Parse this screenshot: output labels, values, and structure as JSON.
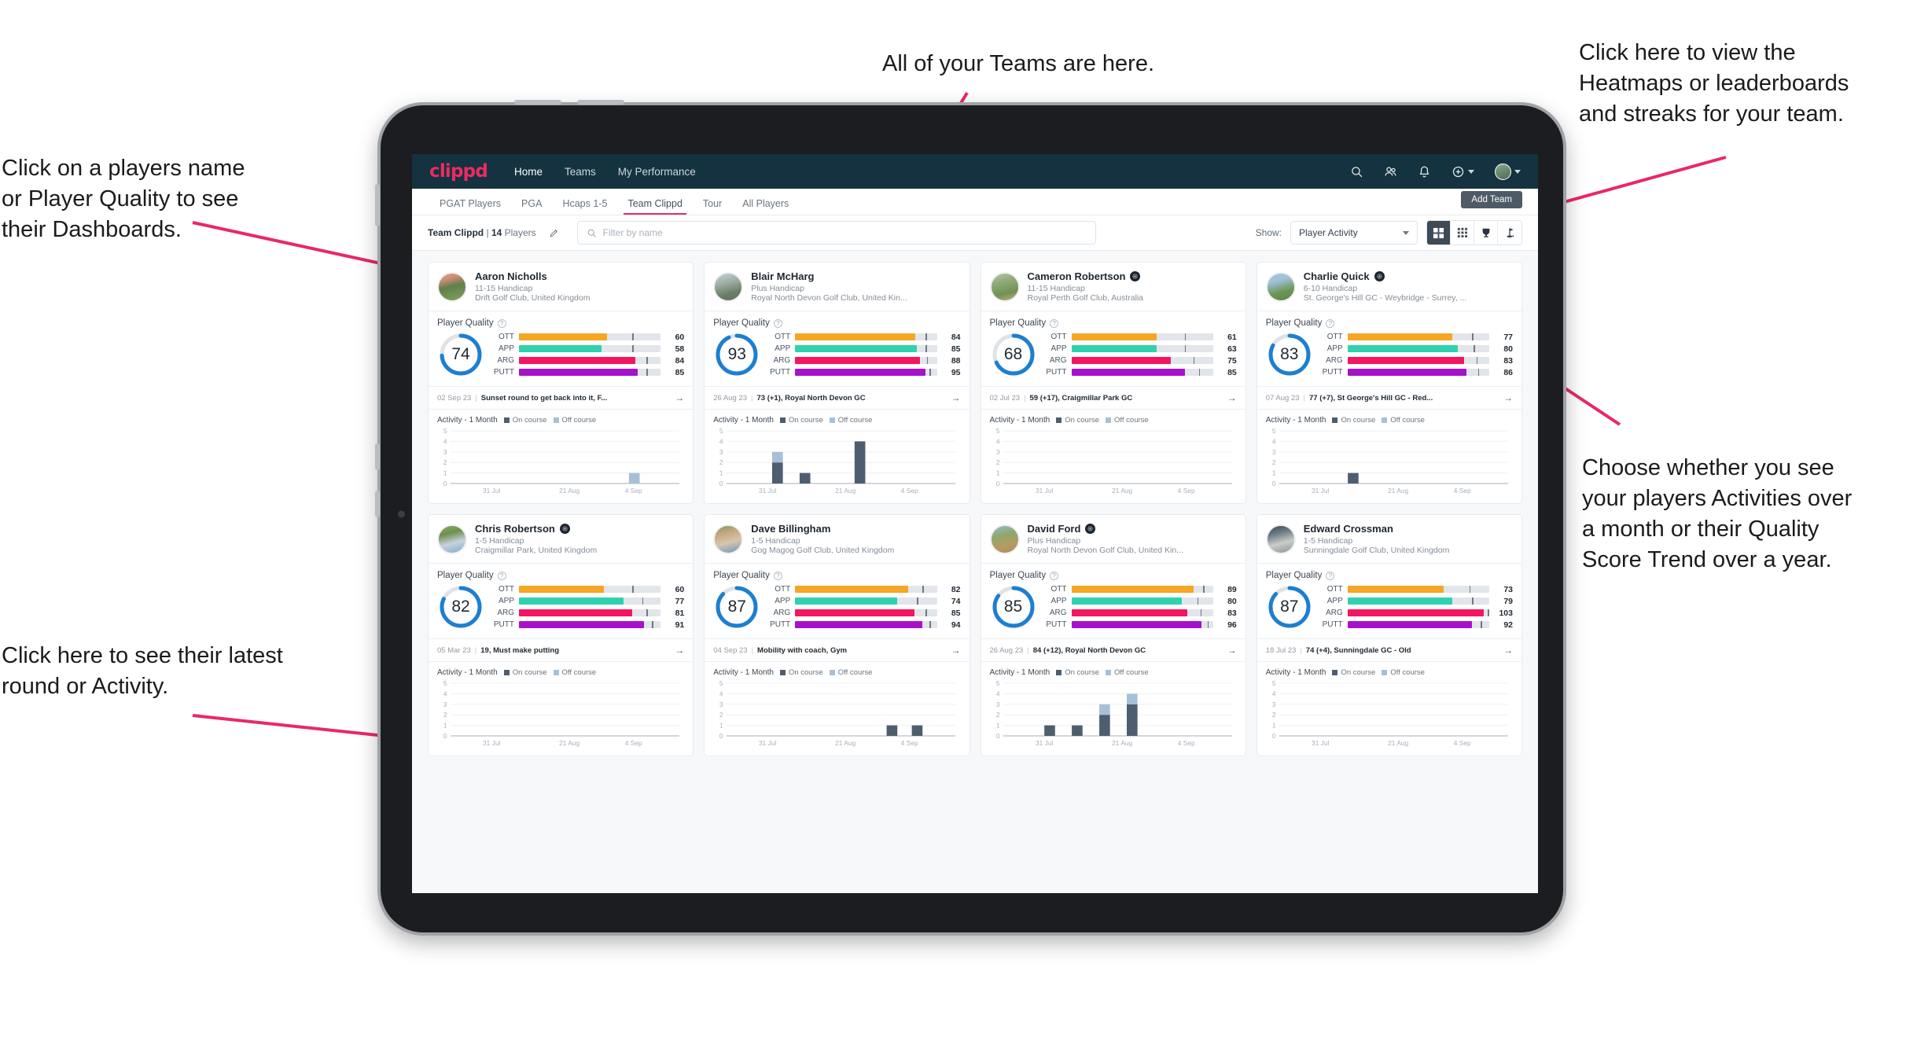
{
  "annotations": [
    {
      "id": "teams",
      "text": "All of your Teams are here."
    },
    {
      "id": "heatmaps",
      "text": "Click here to view the\nHeatmaps or leaderboards\nand streaks for your team."
    },
    {
      "id": "dashboards",
      "text": "Click on a players name\nor Player Quality to see\ntheir Dashboards."
    },
    {
      "id": "activity-choice",
      "text": "Choose whether you see\nyour players Activities over\na month or their Quality\nScore Trend over a year."
    },
    {
      "id": "latest-round",
      "text": "Click here to see their latest\nround or Activity."
    }
  ],
  "app": {
    "logo": "clippd",
    "nav_links": [
      {
        "label": "Home",
        "active": true
      },
      {
        "label": "Teams",
        "active": false
      },
      {
        "label": "My Performance",
        "active": false
      }
    ],
    "nav_icons": [
      "search-icon",
      "people-icon",
      "bell-icon",
      "add-circle-icon",
      "avatar-icon"
    ],
    "tabs": [
      {
        "label": "PGAT Players",
        "active": false
      },
      {
        "label": "PGA",
        "active": false
      },
      {
        "label": "Hcaps 1-5",
        "active": false
      },
      {
        "label": "Team Clippd",
        "active": true
      },
      {
        "label": "Tour",
        "active": false
      },
      {
        "label": "All Players",
        "active": false
      }
    ],
    "add_team_label": "Add Team",
    "toolbar": {
      "team_name": "Team Clippd",
      "separator": "|",
      "player_count": "14",
      "players_word": "Players",
      "edit_icon": "pencil-icon",
      "search_placeholder": "Filter by name",
      "search_value": "",
      "show_label": "Show:",
      "show_value": "Player Activity",
      "show_options": [
        "Player Activity",
        "Quality Score Trend"
      ],
      "view_buttons": [
        {
          "icon": "grid-large-icon",
          "active": true
        },
        {
          "icon": "grid-small-icon",
          "active": false
        },
        {
          "icon": "trophy-icon",
          "active": false
        },
        {
          "icon": "golf-flag-icon",
          "active": false
        }
      ]
    }
  },
  "card_labels": {
    "player_quality": "Player Quality",
    "help_icon": "question-mark-icon",
    "activity_title": "Activity - 1 Month",
    "legend_on": "On course",
    "legend_off": "Off course",
    "arrow_icon": "arrow-right-icon",
    "metric_labels": [
      "OTT",
      "APP",
      "ARG",
      "PUTT"
    ]
  },
  "colors": {
    "brand_pink": "#ec2a63",
    "nav_bg": "#14323f",
    "ring_blue": "#1d7fd0",
    "ott_amber": "#f5a623",
    "app_teal": "#2fd2ae",
    "arg_pink": "#f4165e",
    "putt_purple": "#a711c9",
    "on_course": "#4e5e6e",
    "off_course": "#a7c0d8",
    "add_team_bg": "#4e5b66",
    "toggle_active_bg": "#3e4a55"
  },
  "chart_data": {
    "type": "bar",
    "title": "Activity - 1 Month",
    "xlabel": "",
    "ylabel": "",
    "ylim": [
      0,
      5
    ],
    "yticks": [
      0,
      1,
      2,
      3,
      4,
      5
    ],
    "xticks": [
      "31 Jul",
      "21 Aug",
      "4 Sep"
    ],
    "grid": true,
    "legend": [
      "On course",
      "Off course"
    ],
    "legend_position": "top",
    "stacked": true,
    "panels": [
      {
        "player": "Aaron Nicholls",
        "bars": [
          {
            "pos": 0.78,
            "on": 0,
            "off": 1
          }
        ]
      },
      {
        "player": "Blair McHarg",
        "bars": [
          {
            "pos": 0.2,
            "on": 2,
            "off": 1
          },
          {
            "pos": 0.32,
            "on": 1,
            "off": 0
          },
          {
            "pos": 0.56,
            "on": 4,
            "off": 0
          }
        ]
      },
      {
        "player": "Cameron Robertson",
        "bars": []
      },
      {
        "player": "Charlie Quick",
        "bars": [
          {
            "pos": 0.3,
            "on": 1,
            "off": 0
          }
        ]
      },
      {
        "player": "Chris Robertson",
        "bars": []
      },
      {
        "player": "Dave Billingham",
        "bars": [
          {
            "pos": 0.7,
            "on": 1,
            "off": 0
          },
          {
            "pos": 0.81,
            "on": 1,
            "off": 0
          }
        ]
      },
      {
        "player": "David Ford",
        "bars": [
          {
            "pos": 0.18,
            "on": 1,
            "off": 0
          },
          {
            "pos": 0.3,
            "on": 1,
            "off": 0
          },
          {
            "pos": 0.42,
            "on": 2,
            "off": 1
          },
          {
            "pos": 0.54,
            "on": 3,
            "off": 1
          }
        ]
      },
      {
        "player": "Edward Crossman",
        "bars": []
      }
    ]
  },
  "players": [
    {
      "name": "Aaron Nicholls",
      "verified": false,
      "handicap": "11-15 Handicap",
      "club": "Drift Golf Club, United Kingdom",
      "quality": 74,
      "metrics": [
        {
          "label": "OTT",
          "value": 60,
          "fill": 62,
          "tick": 80
        },
        {
          "label": "APP",
          "value": 58,
          "fill": 58,
          "tick": 80
        },
        {
          "label": "ARG",
          "value": 84,
          "fill": 82,
          "tick": 90
        },
        {
          "label": "PUTT",
          "value": 85,
          "fill": 84,
          "tick": 90
        }
      ],
      "round_date": "02 Sep 23",
      "round_text": "Sunset round to get back into it, F...",
      "avatar_css": "linear-gradient(165deg,#e8a072 0%,#cf8f77 22%,#5f7f4c 48%,#7fa25c 100%)"
    },
    {
      "name": "Blair McHarg",
      "verified": false,
      "handicap": "Plus Handicap",
      "club": "Royal North Devon Golf Club, United Kin...",
      "quality": 93,
      "metrics": [
        {
          "label": "OTT",
          "value": 84,
          "fill": 85,
          "tick": 92
        },
        {
          "label": "APP",
          "value": 85,
          "fill": 86,
          "tick": 92
        },
        {
          "label": "ARG",
          "value": 88,
          "fill": 88,
          "tick": 93
        },
        {
          "label": "PUTT",
          "value": 95,
          "fill": 92,
          "tick": 95
        }
      ],
      "round_date": "26 Aug 23",
      "round_text": "73 (+1), Royal North Devon GC",
      "avatar_css": "linear-gradient(165deg,#c7d3db 0%,#9fb0a4 35%,#6b7f68 70%,#5d7357 100%)"
    },
    {
      "name": "Cameron Robertson",
      "verified": true,
      "handicap": "11-15 Handicap",
      "club": "Royal Perth Golf Club, Australia",
      "quality": 68,
      "metrics": [
        {
          "label": "OTT",
          "value": 61,
          "fill": 60,
          "tick": 80
        },
        {
          "label": "APP",
          "value": 63,
          "fill": 60,
          "tick": 80
        },
        {
          "label": "ARG",
          "value": 75,
          "fill": 70,
          "tick": 86
        },
        {
          "label": "PUTT",
          "value": 85,
          "fill": 80,
          "tick": 90
        }
      ],
      "round_date": "02 Jul 23",
      "round_text": "59 (+17), Craigmillar Park GC",
      "avatar_css": "linear-gradient(165deg,#b6c6a4 0%,#8fa878 35%,#6f9154 70%,#c3b180 100%)"
    },
    {
      "name": "Charlie Quick",
      "verified": true,
      "handicap": "6-10 Handicap",
      "club": "St. George's Hill GC - Weybridge - Surrey, ...",
      "quality": 83,
      "metrics": [
        {
          "label": "OTT",
          "value": 77,
          "fill": 74,
          "tick": 88
        },
        {
          "label": "APP",
          "value": 80,
          "fill": 78,
          "tick": 89
        },
        {
          "label": "ARG",
          "value": 83,
          "fill": 82,
          "tick": 91
        },
        {
          "label": "PUTT",
          "value": 86,
          "fill": 84,
          "tick": 92
        }
      ],
      "round_date": "07 Aug 23",
      "round_text": "77 (+7), St George's Hill GC - Red...",
      "avatar_css": "linear-gradient(165deg,#a8c8e0 0%,#9fc0d6 30%,#6e9556 65%,#5d8449 100%)"
    },
    {
      "name": "Chris Robertson",
      "verified": true,
      "handicap": "1-5 Handicap",
      "club": "Craigmillar Park, United Kingdom",
      "quality": 82,
      "metrics": [
        {
          "label": "OTT",
          "value": 60,
          "fill": 60,
          "tick": 80
        },
        {
          "label": "APP",
          "value": 77,
          "fill": 74,
          "tick": 87
        },
        {
          "label": "ARG",
          "value": 81,
          "fill": 80,
          "tick": 90
        },
        {
          "label": "PUTT",
          "value": 91,
          "fill": 88,
          "tick": 94
        }
      ],
      "round_date": "05 Mar 23",
      "round_text": "19, Must make putting",
      "avatar_css": "linear-gradient(165deg,#88a86a 0%,#6f9150 30%,#c7d2dd 62%,#7fa8cd 100%)"
    },
    {
      "name": "Dave Billingham",
      "verified": false,
      "handicap": "1-5 Handicap",
      "club": "Gog Magog Golf Club, United Kingdom",
      "quality": 87,
      "metrics": [
        {
          "label": "OTT",
          "value": 82,
          "fill": 80,
          "tick": 90
        },
        {
          "label": "APP",
          "value": 74,
          "fill": 72,
          "tick": 86
        },
        {
          "label": "ARG",
          "value": 85,
          "fill": 84,
          "tick": 92
        },
        {
          "label": "PUTT",
          "value": 94,
          "fill": 90,
          "tick": 95
        }
      ],
      "round_date": "04 Sep 23",
      "round_text": "Mobility with coach, Gym",
      "avatar_css": "linear-gradient(165deg,#7a9a5c 0%,#c9a882 30%,#d6c5ae 60%,#6f95bd 100%)"
    },
    {
      "name": "David Ford",
      "verified": true,
      "handicap": "Plus Handicap",
      "club": "Royal North Devon Golf Club, United Kin...",
      "quality": 85,
      "metrics": [
        {
          "label": "OTT",
          "value": 89,
          "fill": 86,
          "tick": 93
        },
        {
          "label": "APP",
          "value": 80,
          "fill": 78,
          "tick": 89
        },
        {
          "label": "ARG",
          "value": 83,
          "fill": 82,
          "tick": 91
        },
        {
          "label": "PUTT",
          "value": 96,
          "fill": 92,
          "tick": 96
        }
      ],
      "round_date": "26 Aug 23",
      "round_text": "84 (+12), Royal North Devon GC",
      "avatar_css": "linear-gradient(165deg,#9bbcd8 0%,#8ea86c 35%,#b89a62 70%,#a38d5c 100%)"
    },
    {
      "name": "Edward Crossman",
      "verified": false,
      "handicap": "1-5 Handicap",
      "club": "Sunningdale Golf Club, United Kingdom",
      "quality": 87,
      "metrics": [
        {
          "label": "OTT",
          "value": 73,
          "fill": 68,
          "tick": 86
        },
        {
          "label": "APP",
          "value": 79,
          "fill": 74,
          "tick": 88
        },
        {
          "label": "ARG",
          "value": 103,
          "fill": 96,
          "tick": 99
        },
        {
          "label": "PUTT",
          "value": 92,
          "fill": 88,
          "tick": 94
        }
      ],
      "round_date": "18 Jul 23",
      "round_text": "74 (+4), Sunningdale GC - Old",
      "avatar_css": "linear-gradient(165deg,#3b4a52 0%,#6b7d86 30%,#c9ccc8 62%,#8d9690 100%)"
    }
  ]
}
